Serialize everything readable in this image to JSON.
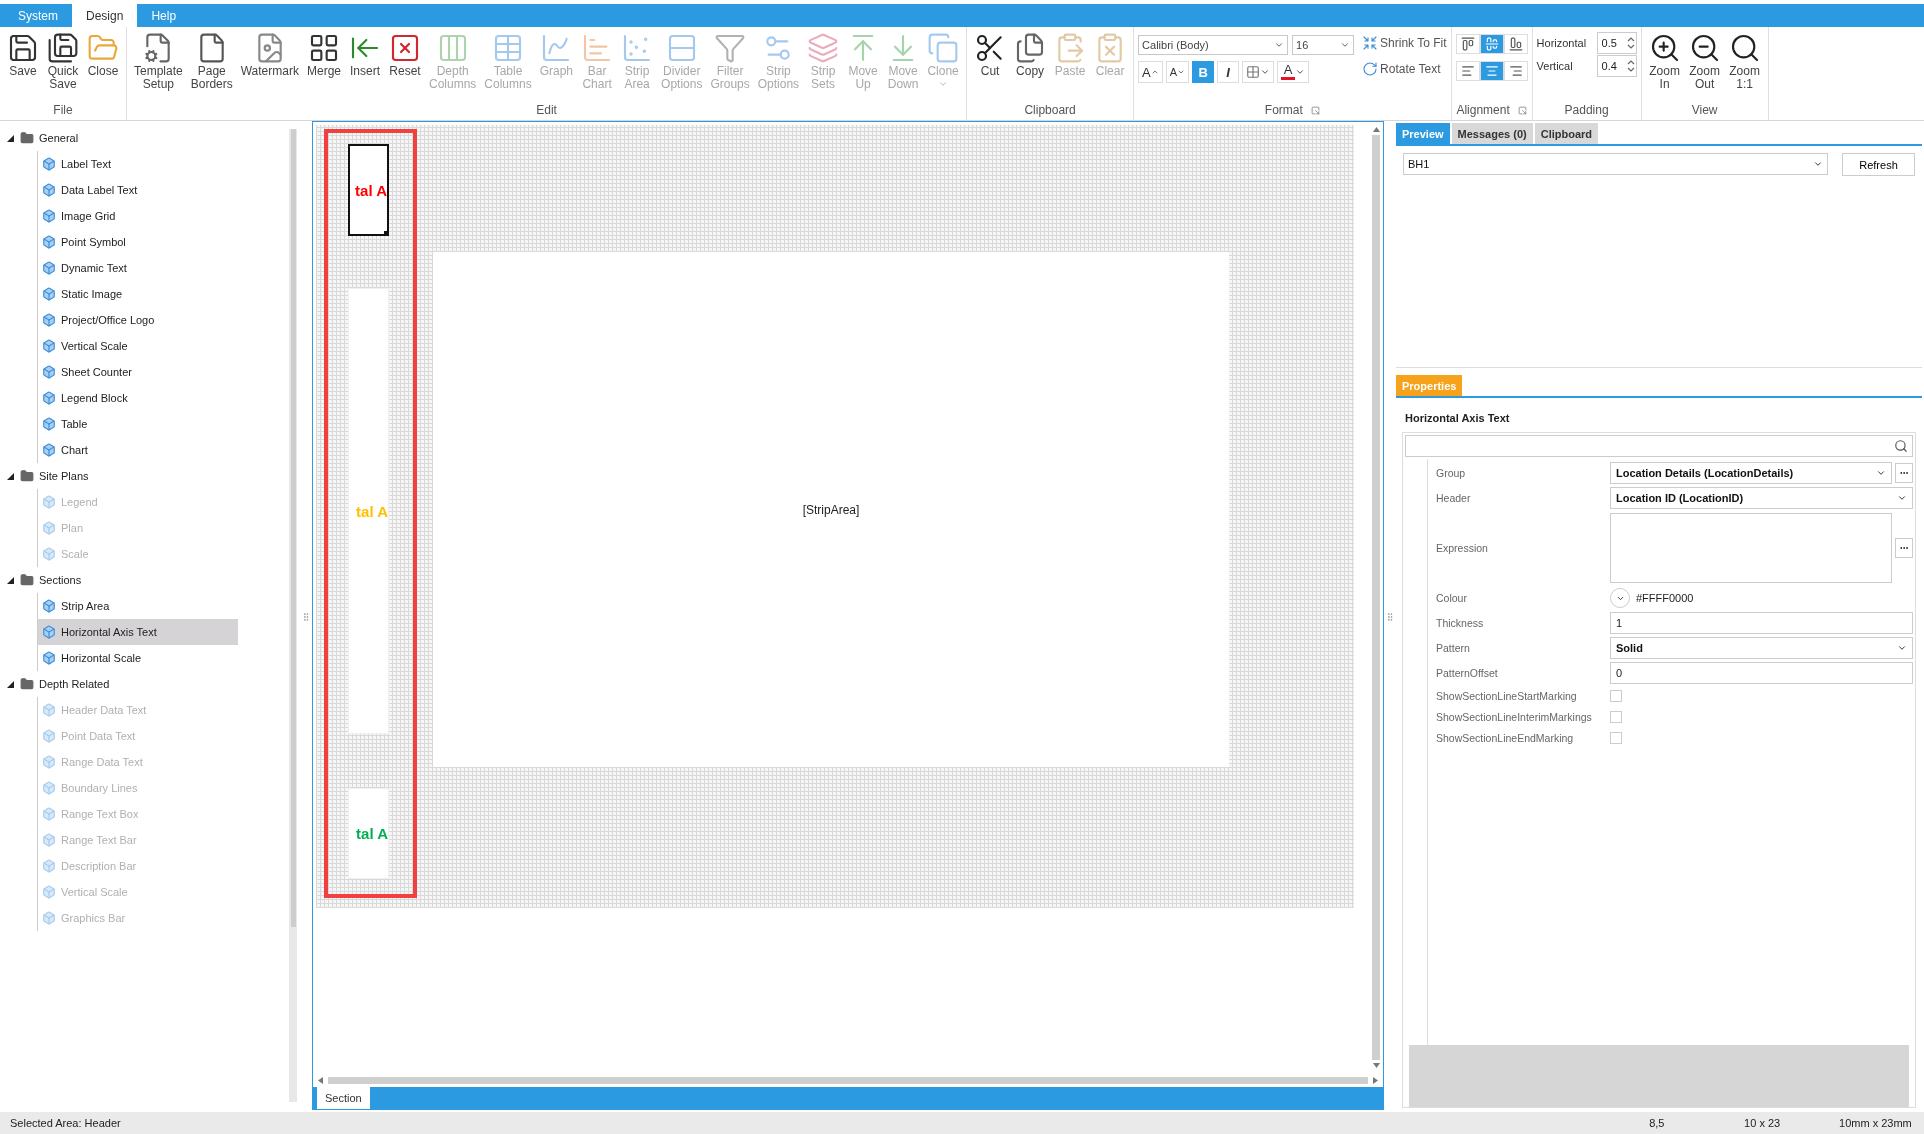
{
  "menu_tabs": [
    {
      "label": "System",
      "selected": false
    },
    {
      "label": "Design",
      "selected": true
    },
    {
      "label": "Help",
      "selected": false
    }
  ],
  "ribbon_groups": [
    {
      "label": "File",
      "kind": "buttons",
      "launcher": false,
      "buttons": [
        {
          "label": "Save",
          "kind": "save",
          "disabled": false
        },
        {
          "label": "Quick Save",
          "kind": "quicksave",
          "disabled": false
        },
        {
          "label": "Close",
          "kind": "close",
          "disabled": false
        }
      ]
    },
    {
      "label": "Edit",
      "kind": "buttons",
      "launcher": false,
      "buttons": [
        {
          "label": "Template Setup",
          "kind": "template",
          "disabled": false
        },
        {
          "label": "Page Borders",
          "kind": "page",
          "disabled": false
        },
        {
          "label": "Watermark",
          "kind": "watermark",
          "disabled": false
        },
        {
          "label": "Merge",
          "kind": "merge",
          "disabled": false
        },
        {
          "label": "Insert",
          "kind": "insert",
          "disabled": false
        },
        {
          "label": "Reset",
          "kind": "reset",
          "disabled": false
        },
        {
          "label": "Depth Columns",
          "kind": "columns",
          "disabled": true
        },
        {
          "label": "Table Columns",
          "kind": "table",
          "disabled": true
        },
        {
          "label": "Graph",
          "kind": "graph",
          "disabled": true
        },
        {
          "label": "Bar Chart",
          "kind": "bar",
          "disabled": true
        },
        {
          "label": "Strip Area",
          "kind": "strip",
          "disabled": true
        },
        {
          "label": "Divider Options",
          "kind": "divider",
          "disabled": true
        },
        {
          "label": "Filter Groups",
          "kind": "filter",
          "disabled": true
        },
        {
          "label": "Strip Options",
          "kind": "stripoptions",
          "disabled": true
        },
        {
          "label": "Strip Sets",
          "kind": "stripsets",
          "disabled": true
        },
        {
          "label": "Move Up",
          "kind": "up",
          "disabled": true
        },
        {
          "label": "Move Down",
          "kind": "down",
          "disabled": true
        },
        {
          "label": "Clone",
          "kind": "clone",
          "disabled": true,
          "dropdown": true
        }
      ]
    },
    {
      "label": "Clipboard",
      "kind": "buttons",
      "launcher": false,
      "buttons": [
        {
          "label": "Cut",
          "kind": "cut",
          "disabled": false
        },
        {
          "label": "Copy",
          "kind": "copy",
          "disabled": false
        },
        {
          "label": "Paste",
          "kind": "paste",
          "disabled": true
        },
        {
          "label": "Clear",
          "kind": "clear",
          "disabled": true
        }
      ]
    },
    {
      "label": "Format",
      "kind": "format",
      "launcher": true,
      "font": "Calibri (Body)",
      "size": "16",
      "actions": [
        {
          "label": "Shrink To Fit",
          "kind": "shrink"
        },
        {
          "label": "Rotate Text",
          "kind": "rotate"
        }
      ],
      "toggles": [
        {
          "kind": "grow",
          "label": "A",
          "selected": false
        },
        {
          "kind": "shrink",
          "label": "A",
          "selected": false
        },
        {
          "kind": "bold",
          "label": "B",
          "selected": true
        },
        {
          "kind": "italic",
          "label": "I",
          "selected": false
        },
        {
          "kind": "borders",
          "selected": false
        },
        {
          "kind": "fontcolor",
          "label": "A",
          "selected": false,
          "color": "#e81123"
        }
      ]
    },
    {
      "label": "Alignment",
      "kind": "alignment",
      "launcher": true,
      "rows": [
        {
          "buttons": [
            {
              "kind": "top",
              "selected": false
            },
            {
              "kind": "middle",
              "selected": true
            },
            {
              "kind": "bottom",
              "selected": false
            }
          ]
        },
        {
          "buttons": [
            {
              "kind": "left",
              "selected": false
            },
            {
              "kind": "center",
              "selected": true
            },
            {
              "kind": "right",
              "selected": false
            }
          ]
        }
      ]
    },
    {
      "label": "Padding",
      "kind": "padding",
      "launcher": false,
      "fields": [
        {
          "label": "Horizontal",
          "value": "0.5"
        },
        {
          "label": "Vertical",
          "value": "0.4"
        }
      ]
    },
    {
      "label": "View",
      "kind": "buttons",
      "launcher": false,
      "buttons": [
        {
          "label": "Zoom In",
          "kind": "zoomin",
          "disabled": false
        },
        {
          "label": "Zoom Out",
          "kind": "zoomout",
          "disabled": false
        },
        {
          "label": "Zoom 1:1",
          "kind": "zoom11",
          "disabled": false
        }
      ]
    }
  ],
  "toolbox": [
    {
      "label": "General",
      "expanded": true,
      "children": [
        {
          "label": "Label Text",
          "disabled": false,
          "selected": false
        },
        {
          "label": "Data Label Text",
          "disabled": false,
          "selected": false
        },
        {
          "label": "Image Grid",
          "disabled": false,
          "selected": false
        },
        {
          "label": "Point Symbol",
          "disabled": false,
          "selected": false
        },
        {
          "label": "Dynamic Text",
          "disabled": false,
          "selected": false
        },
        {
          "label": "Static Image",
          "disabled": false,
          "selected": false
        },
        {
          "label": "Project/Office Logo",
          "disabled": false,
          "selected": false
        },
        {
          "label": "Vertical Scale",
          "disabled": false,
          "selected": false
        },
        {
          "label": "Sheet Counter",
          "disabled": false,
          "selected": false
        },
        {
          "label": "Legend Block",
          "disabled": false,
          "selected": false
        },
        {
          "label": "Table",
          "disabled": false,
          "selected": false
        },
        {
          "label": "Chart",
          "disabled": false,
          "selected": false
        }
      ]
    },
    {
      "label": "Site Plans",
      "expanded": true,
      "children": [
        {
          "label": "Legend",
          "disabled": true,
          "selected": false
        },
        {
          "label": "Plan",
          "disabled": true,
          "selected": false
        },
        {
          "label": "Scale",
          "disabled": true,
          "selected": false
        }
      ]
    },
    {
      "label": "Sections",
      "expanded": true,
      "children": [
        {
          "label": "Strip Area",
          "disabled": false,
          "selected": false
        },
        {
          "label": "Horizontal Axis Text",
          "disabled": false,
          "selected": true
        },
        {
          "label": "Horizontal Scale",
          "disabled": false,
          "selected": false
        }
      ]
    },
    {
      "label": "Depth Related",
      "expanded": true,
      "children": [
        {
          "label": "Header Data Text",
          "disabled": true,
          "selected": false
        },
        {
          "label": "Point Data Text",
          "disabled": true,
          "selected": false
        },
        {
          "label": "Range Data Text",
          "disabled": true,
          "selected": false
        },
        {
          "label": "Boundary Lines",
          "disabled": true,
          "selected": false
        },
        {
          "label": "Range Text Box",
          "disabled": true,
          "selected": false
        },
        {
          "label": "Range Text Bar",
          "disabled": true,
          "selected": false
        },
        {
          "label": "Description Bar",
          "disabled": true,
          "selected": false
        },
        {
          "label": "Vertical Scale",
          "disabled": true,
          "selected": false
        },
        {
          "label": "Graphics Bar",
          "disabled": true,
          "selected": false
        }
      ]
    }
  ],
  "canvas": {
    "elements": [
      {
        "text": "tal A",
        "color": "#ff0000",
        "selected": true
      },
      {
        "text": "tal A",
        "color": "#ffc000",
        "selected": false
      },
      {
        "text": "tal A",
        "color": "#00b050",
        "selected": false
      }
    ],
    "strip_area": "[StripArea]",
    "tabs": [
      {
        "label": "Section",
        "selected": true
      }
    ]
  },
  "preview": {
    "tabs": [
      {
        "label": "Preview",
        "selected": true
      },
      {
        "label": "Messages (0)",
        "selected": false
      },
      {
        "label": "Clipboard",
        "selected": false
      }
    ],
    "source": "BH1",
    "button": "Refresh"
  },
  "properties": {
    "tab": "Properties",
    "title": "Horizontal Axis Text",
    "rows": [
      {
        "kind": "combo",
        "label": "Group",
        "value": "Location Details (LocationDetails)",
        "ellipsis": true
      },
      {
        "kind": "combo",
        "label": "Header",
        "value": "Location ID (LocationID)",
        "ellipsis": false
      },
      {
        "kind": "textarea",
        "label": "Expression",
        "ellipsis": true
      },
      {
        "kind": "color",
        "label": "Colour",
        "value": "#FFFF0000"
      },
      {
        "kind": "text",
        "label": "Thickness",
        "value": "1"
      },
      {
        "kind": "combo",
        "label": "Pattern",
        "value": "Solid",
        "ellipsis": false
      },
      {
        "kind": "text",
        "label": "PatternOffset",
        "value": "0"
      },
      {
        "kind": "checkbox",
        "label": "ShowSectionLineStartMarking",
        "checked": false
      },
      {
        "kind": "checkbox",
        "label": "ShowSectionLineInterimMarkings",
        "checked": false
      },
      {
        "kind": "checkbox",
        "label": "ShowSectionLineEndMarking",
        "checked": false
      }
    ]
  },
  "status_bar": [
    "Selected Area: Header",
    "8,5",
    "10 x 23",
    "10mm x 23mm"
  ]
}
